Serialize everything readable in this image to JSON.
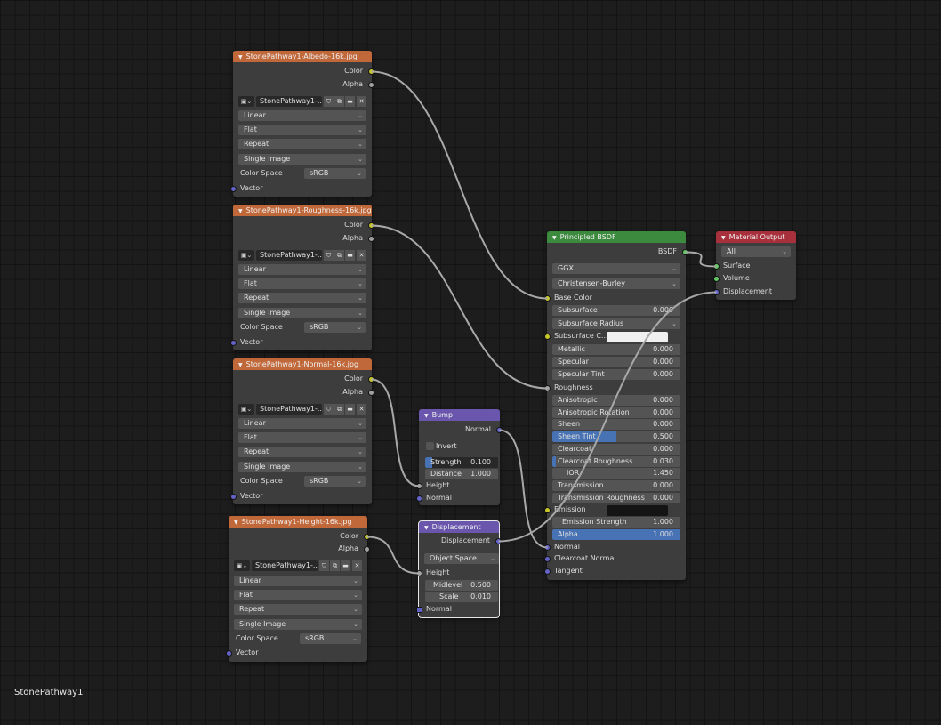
{
  "status_label": "StonePathway1",
  "colors": {
    "texture_header": "#c0683a",
    "shader_header": "#3b8a3e",
    "output_header": "#a82f3c",
    "vector_header": "#6a56ad",
    "socket_color": "#c7c729",
    "socket_float": "#a1a1a1",
    "socket_vector": "#6363c7",
    "socket_shader": "#63c763"
  },
  "tex_albedo": {
    "title": "StonePathway1-Albedo-16k.jpg",
    "out_color": "Color",
    "out_alpha": "Alpha",
    "image_name": "StonePathway1-...",
    "interpolation": "Linear",
    "projection": "Flat",
    "extension": "Repeat",
    "source": "Single Image",
    "color_space_label": "Color Space",
    "color_space": "sRGB",
    "in_vector": "Vector"
  },
  "tex_roughness": {
    "title": "StonePathway1-Roughness-16k.jpg",
    "out_color": "Color",
    "out_alpha": "Alpha",
    "image_name": "StonePathway1-...",
    "interpolation": "Linear",
    "projection": "Flat",
    "extension": "Repeat",
    "source": "Single Image",
    "color_space_label": "Color Space",
    "color_space": "sRGB",
    "in_vector": "Vector"
  },
  "tex_normal": {
    "title": "StonePathway1-Normal-16k.jpg",
    "out_color": "Color",
    "out_alpha": "Alpha",
    "image_name": "StonePathway1-...",
    "interpolation": "Linear",
    "projection": "Flat",
    "extension": "Repeat",
    "source": "Single Image",
    "color_space_label": "Color Space",
    "color_space": "sRGB",
    "in_vector": "Vector"
  },
  "tex_height": {
    "title": "StonePathway1-Height-16k.jpg",
    "out_color": "Color",
    "out_alpha": "Alpha",
    "image_name": "StonePathway1-...",
    "interpolation": "Linear",
    "projection": "Flat",
    "extension": "Repeat",
    "source": "Single Image",
    "color_space_label": "Color Space",
    "color_space": "sRGB",
    "in_vector": "Vector"
  },
  "bump": {
    "title": "Bump",
    "out_normal": "Normal",
    "invert": "Invert",
    "strength_label": "Strength",
    "strength": "0.100",
    "strength_fraction": 0.1,
    "distance_label": "Distance",
    "distance": "1.000",
    "in_height": "Height",
    "in_normal": "Normal"
  },
  "displacement": {
    "title": "Displacement",
    "out_displacement": "Displacement",
    "space": "Object Space",
    "in_height": "Height",
    "midlevel_label": "Midlevel",
    "midlevel": "0.500",
    "scale_label": "Scale",
    "scale": "0.010",
    "in_normal": "Normal"
  },
  "bsdf": {
    "title": "Principled BSDF",
    "out_bsdf": "BSDF",
    "distribution": "GGX",
    "subsurface_method": "Christensen-Burley",
    "base_color": "Base Color",
    "subsurface_label": "Subsurface",
    "subsurface": "0.000",
    "subsurface_radius": "Subsurface Radius",
    "subsurface_color": "Subsurface C...",
    "metallic_label": "Metallic",
    "metallic": "0.000",
    "specular_label": "Specular",
    "specular": "0.000",
    "specular_tint_label": "Specular Tint",
    "specular_tint": "0.000",
    "roughness": "Roughness",
    "anisotropic_label": "Anisotropic",
    "anisotropic": "0.000",
    "anisotropic_rotation_label": "Anisotropic Rotation",
    "anisotropic_rotation": "0.000",
    "sheen_label": "Sheen",
    "sheen": "0.000",
    "sheen_tint_label": "Sheen Tint",
    "sheen_tint": "0.500",
    "sheen_tint_fraction": 0.5,
    "clearcoat_label": "Clearcoat",
    "clearcoat": "0.000",
    "clearcoat_roughness_label": "Clearcoat Roughness",
    "clearcoat_roughness": "0.030",
    "clearcoat_roughness_fraction": 0.03,
    "ior_label": "IOR",
    "ior": "1.450",
    "transmission_label": "Transmission",
    "transmission": "0.000",
    "transmission_roughness_label": "Transmission Roughness",
    "transmission_roughness": "0.000",
    "emission": "Emission",
    "emission_strength_label": "Emission Strength",
    "emission_strength": "1.000",
    "alpha_label": "Alpha",
    "alpha": "1.000",
    "alpha_fraction": 1.0,
    "normal": "Normal",
    "clearcoat_normal": "Clearcoat Normal",
    "tangent": "Tangent"
  },
  "material_output": {
    "title": "Material Output",
    "target": "All",
    "surface": "Surface",
    "volume": "Volume",
    "displacement": "Displacement"
  }
}
